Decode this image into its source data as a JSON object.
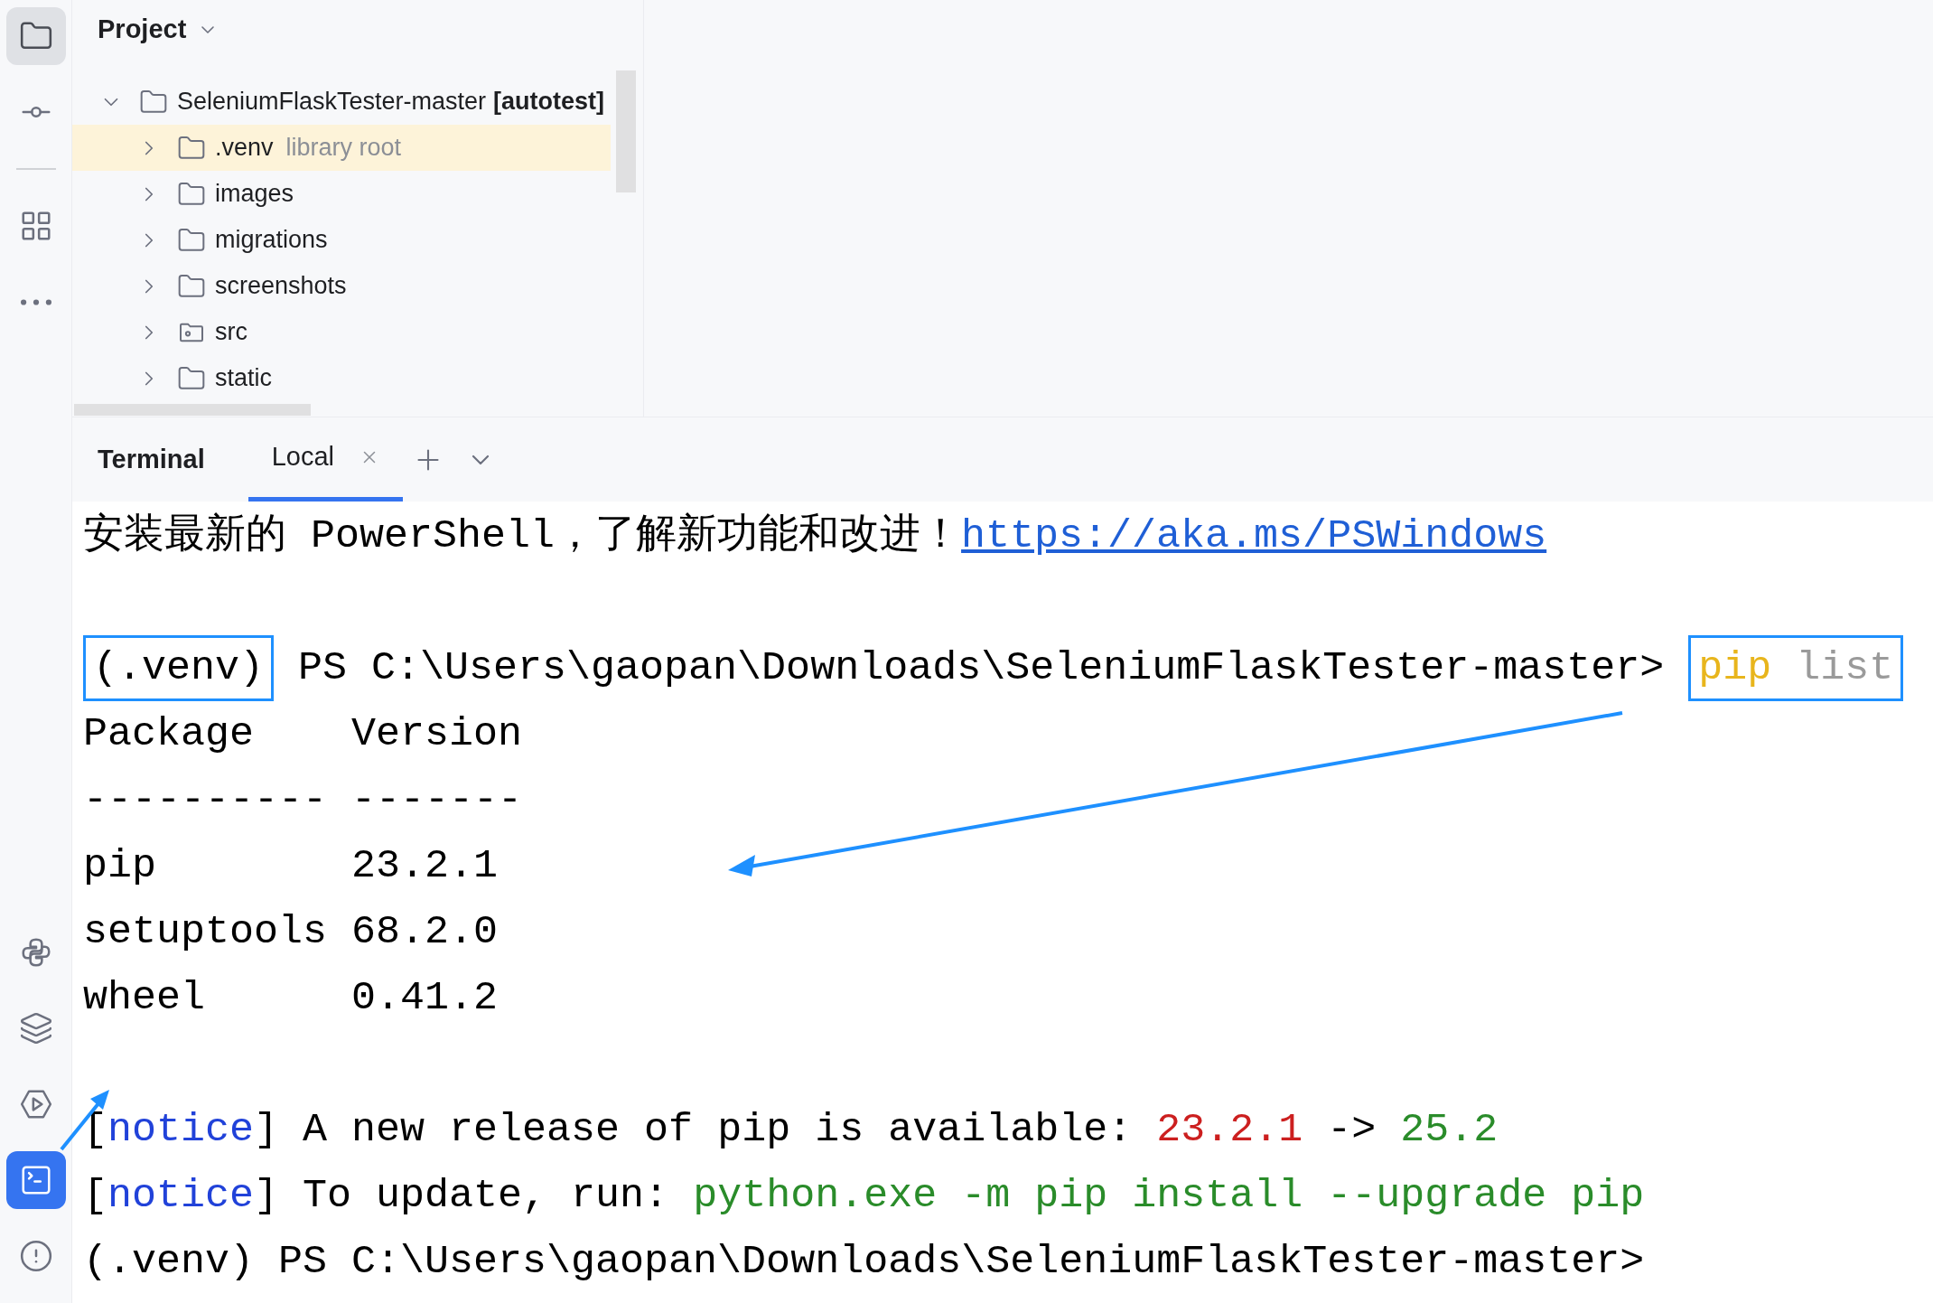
{
  "tool_rail": {
    "top": [
      {
        "kind": "project",
        "selected": true
      },
      {
        "kind": "commit",
        "selected": false
      },
      {
        "kind": "divider"
      },
      {
        "kind": "structure",
        "selected": false
      },
      {
        "kind": "more",
        "selected": false
      }
    ],
    "bottom": [
      {
        "kind": "python",
        "selected": false
      },
      {
        "kind": "layers",
        "selected": false
      },
      {
        "kind": "run",
        "selected": false
      },
      {
        "kind": "terminal",
        "selected": true
      },
      {
        "kind": "problems",
        "selected": false
      }
    ]
  },
  "project_panel": {
    "title": "Project",
    "tree": [
      {
        "name": "SeleniumFlaskTester-master",
        "tag": "[autotest]",
        "kind": "folder",
        "expanded": true,
        "highlighted": false,
        "children": [
          {
            "name": ".venv",
            "hint": "library root",
            "kind": "folder",
            "expanded": false,
            "highlighted": true
          },
          {
            "name": "images",
            "kind": "folder",
            "expanded": false,
            "highlighted": false
          },
          {
            "name": "migrations",
            "kind": "folder",
            "expanded": false,
            "highlighted": false
          },
          {
            "name": "screenshots",
            "kind": "folder",
            "expanded": false,
            "highlighted": false
          },
          {
            "name": "src",
            "kind": "source",
            "expanded": false,
            "highlighted": false
          },
          {
            "name": "static",
            "kind": "folder",
            "expanded": false,
            "highlighted": false
          }
        ]
      }
    ]
  },
  "terminal": {
    "title": "Terminal",
    "tabs": [
      {
        "label": "Local",
        "selected": true
      }
    ],
    "lines": [
      {
        "kind": "text",
        "segments": [
          {
            "text": "安装最新的 PowerShell，了解新功能和改进！",
            "color": "#000000",
            "link": false,
            "boxed": false
          },
          {
            "text": "https://aka.ms/PSWindows",
            "color": "#1f5fd6",
            "link": true,
            "boxed": false
          }
        ]
      },
      {
        "kind": "blank"
      },
      {
        "kind": "text",
        "segments": [
          {
            "text": "(.venv)",
            "color": "#000000",
            "link": false,
            "boxed": true
          },
          {
            "text": " PS C:\\Users\\gaopan\\Downloads\\SeleniumFlaskTester-master> ",
            "color": "#000000",
            "link": false,
            "boxed": false
          },
          {
            "text": "pip",
            "color": "#e8b51c",
            "link": false,
            "boxed": true
          },
          {
            "text": " list",
            "color": "#9a9a9a",
            "link": false,
            "boxed": true
          }
        ]
      },
      {
        "kind": "text",
        "segments": [
          {
            "text": "Package    Version",
            "color": "#000000",
            "link": false,
            "boxed": false
          }
        ]
      },
      {
        "kind": "text",
        "segments": [
          {
            "text": "---------- -------",
            "color": "#000000",
            "link": false,
            "boxed": false
          }
        ]
      },
      {
        "kind": "text",
        "segments": [
          {
            "text": "pip        23.2.1",
            "color": "#000000",
            "link": false,
            "boxed": false
          }
        ]
      },
      {
        "kind": "text",
        "segments": [
          {
            "text": "setuptools 68.2.0",
            "color": "#000000",
            "link": false,
            "boxed": false
          }
        ]
      },
      {
        "kind": "text",
        "segments": [
          {
            "text": "wheel      0.41.2",
            "color": "#000000",
            "link": false,
            "boxed": false
          }
        ]
      },
      {
        "kind": "blank"
      },
      {
        "kind": "text",
        "segments": [
          {
            "text": "[",
            "color": "#000000",
            "link": false,
            "boxed": false
          },
          {
            "text": "notice",
            "color": "#2142d9",
            "link": false,
            "boxed": false
          },
          {
            "text": "] A new release of pip is available: ",
            "color": "#000000",
            "link": false,
            "boxed": false
          },
          {
            "text": "23.2.1",
            "color": "#cc1f1f",
            "link": false,
            "boxed": false
          },
          {
            "text": " -> ",
            "color": "#000000",
            "link": false,
            "boxed": false
          },
          {
            "text": "25.2",
            "color": "#2a8c2a",
            "link": false,
            "boxed": false
          }
        ]
      },
      {
        "kind": "text",
        "segments": [
          {
            "text": "[",
            "color": "#000000",
            "link": false,
            "boxed": false
          },
          {
            "text": "notice",
            "color": "#2142d9",
            "link": false,
            "boxed": false
          },
          {
            "text": "] To update, run: ",
            "color": "#000000",
            "link": false,
            "boxed": false
          },
          {
            "text": "python.exe -m pip install --upgrade pip",
            "color": "#2a8c2a",
            "link": false,
            "boxed": false
          }
        ]
      },
      {
        "kind": "text",
        "segments": [
          {
            "text": "(.venv) PS C:\\Users\\gaopan\\Downloads\\SeleniumFlaskTester-master>",
            "color": "#000000",
            "link": false,
            "boxed": false
          }
        ]
      }
    ]
  }
}
